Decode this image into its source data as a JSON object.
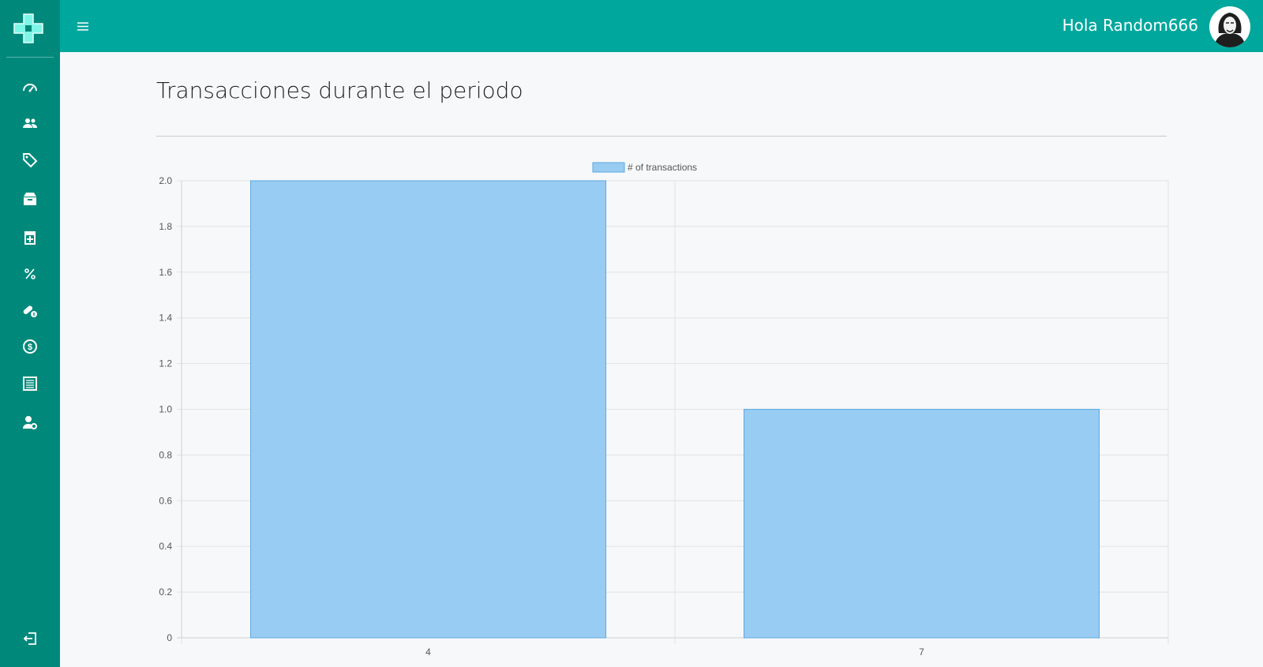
{
  "header": {
    "greeting": "Hola Random666"
  },
  "page": {
    "title": "Transacciones durante el periodo"
  },
  "sidebar": {
    "items": [
      {
        "icon": "dashboard-icon"
      },
      {
        "icon": "users-icon"
      },
      {
        "icon": "tags-icon"
      },
      {
        "icon": "inventory-box-icon"
      },
      {
        "icon": "medicine-jar-icon"
      },
      {
        "icon": "percent-icon"
      },
      {
        "icon": "pills-info-icon"
      },
      {
        "icon": "money-circle-icon"
      },
      {
        "icon": "receipt-list-icon"
      },
      {
        "icon": "user-settings-icon"
      }
    ],
    "logout_icon": "logout-icon"
  },
  "colors": {
    "sidebar": "#00897b",
    "topbar": "#00a79d",
    "bar_fill": "#99ccf2",
    "bar_stroke": "#5aa8e0"
  },
  "chart_data": {
    "type": "bar",
    "categories": [
      "4",
      "7"
    ],
    "series": [
      {
        "name": "# of transactions",
        "values": [
          2,
          1
        ]
      }
    ],
    "ylim": [
      0,
      2
    ],
    "yticks": [
      "0",
      "0.2",
      "0.4",
      "0.6",
      "0.8",
      "1.0",
      "1.2",
      "1.4",
      "1.6",
      "1.8",
      "2.0"
    ],
    "grid": true,
    "legend": "top-center"
  }
}
